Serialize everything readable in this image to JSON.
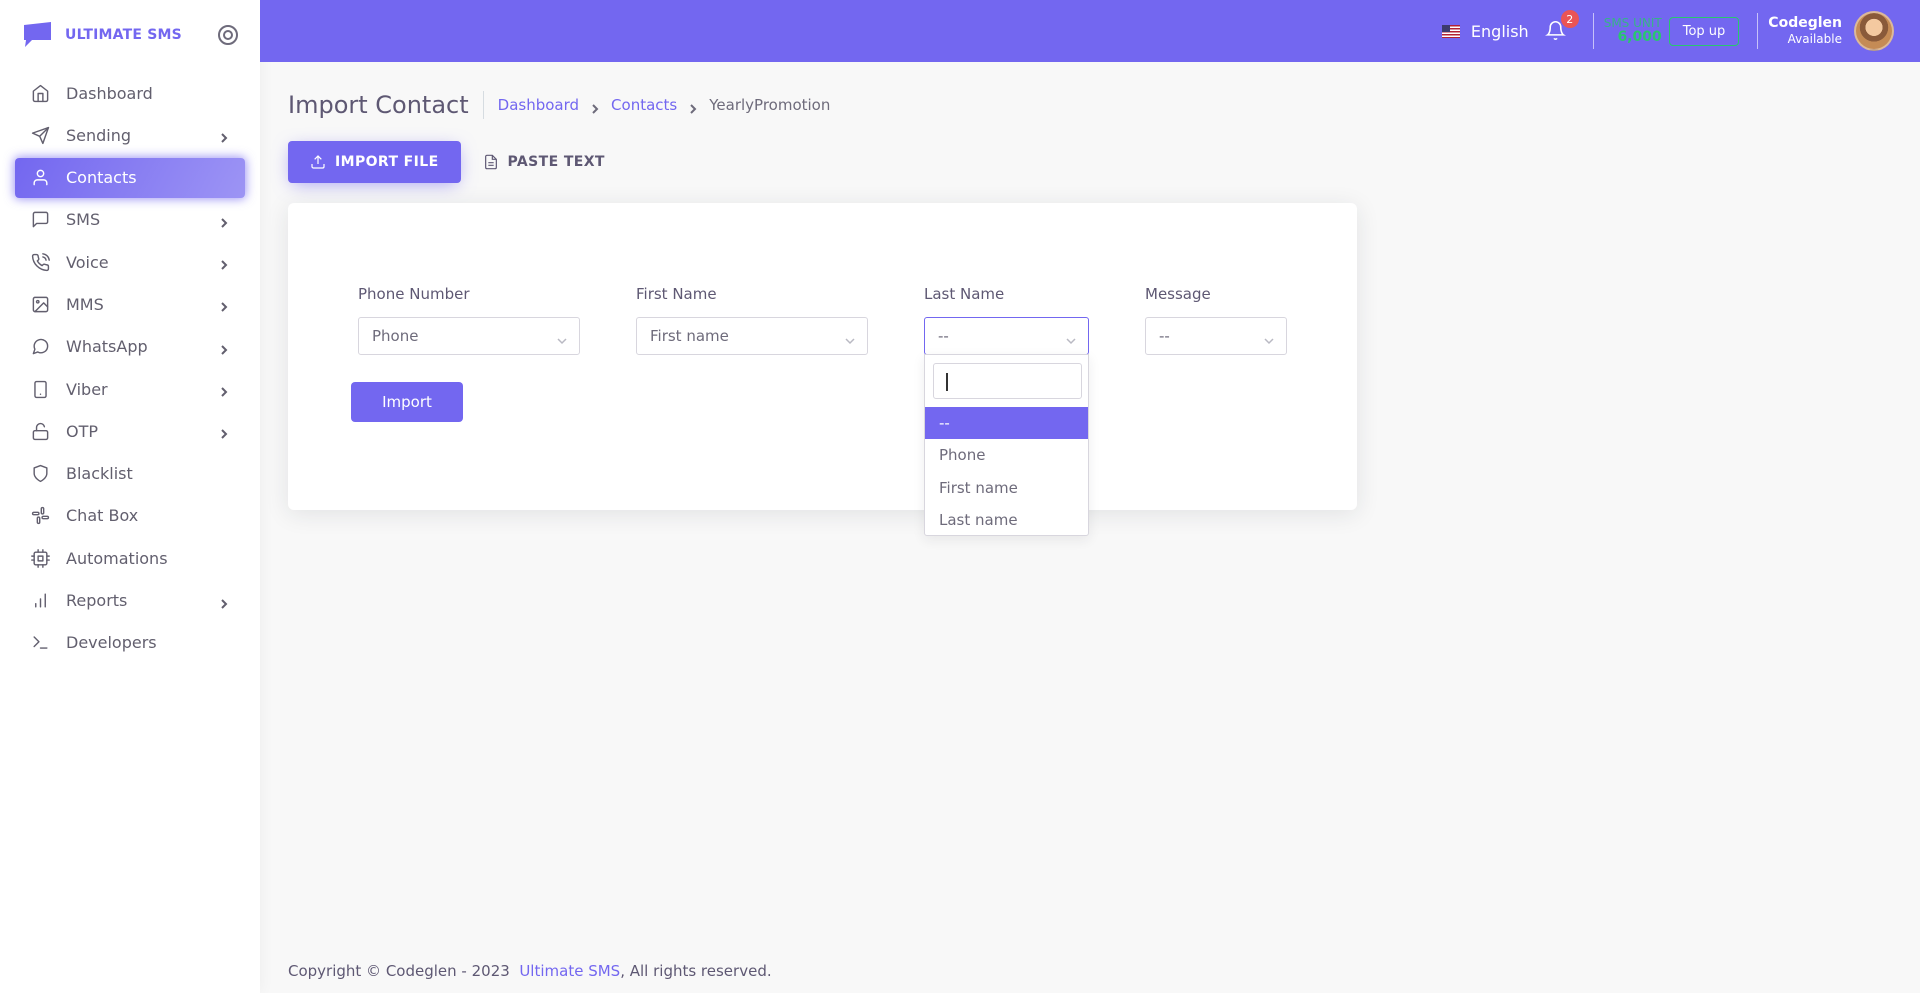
{
  "brand": {
    "name": "ULTIMATE SMS"
  },
  "sidebar": {
    "items": [
      {
        "label": "Dashboard",
        "icon": "home-icon"
      },
      {
        "label": "Sending",
        "icon": "send-icon"
      },
      {
        "label": "Contacts",
        "icon": "user-icon"
      },
      {
        "label": "SMS",
        "icon": "message-square-icon"
      },
      {
        "label": "Voice",
        "icon": "phone-call-icon"
      },
      {
        "label": "MMS",
        "icon": "image-icon"
      },
      {
        "label": "WhatsApp",
        "icon": "message-circle-icon"
      },
      {
        "label": "Viber",
        "icon": "tablet-icon"
      },
      {
        "label": "OTP",
        "icon": "unlock-icon"
      },
      {
        "label": "Blacklist",
        "icon": "shield-icon"
      },
      {
        "label": "Chat Box",
        "icon": "slack-icon"
      },
      {
        "label": "Automations",
        "icon": "cpu-icon"
      },
      {
        "label": "Reports",
        "icon": "bar-chart-icon"
      },
      {
        "label": "Developers",
        "icon": "terminal-icon"
      }
    ]
  },
  "header": {
    "language": "English",
    "notifications": "2",
    "sms_unit_label": "SMS UNIT",
    "sms_unit_value": "6,000",
    "topup_label": "Top up",
    "user_name": "Codeglen",
    "user_status": "Available"
  },
  "page": {
    "title": "Import Contact",
    "breadcrumb": [
      "Dashboard",
      "Contacts",
      "YearlyPromotion"
    ]
  },
  "tabs": [
    "IMPORT FILE",
    "PASTE TEXT"
  ],
  "form": {
    "fields": [
      {
        "label": "Phone Number",
        "value": "Phone"
      },
      {
        "label": "First Name",
        "value": "First name"
      },
      {
        "label": "Last Name",
        "value": "--"
      },
      {
        "label": "Message",
        "value": "--"
      }
    ],
    "import_label": "Import"
  },
  "dropdown": {
    "search_value": "",
    "options": [
      "--",
      "Phone",
      "First name",
      "Last name"
    ],
    "selected": "--"
  },
  "footer": {
    "text": "Copyright © Codeglen - 2023",
    "link": "Ultimate SMS",
    "suffix": ", All rights reserved."
  },
  "colors": {
    "primary": "#7367f0",
    "success": "#28c76f",
    "danger": "#ea5455"
  }
}
